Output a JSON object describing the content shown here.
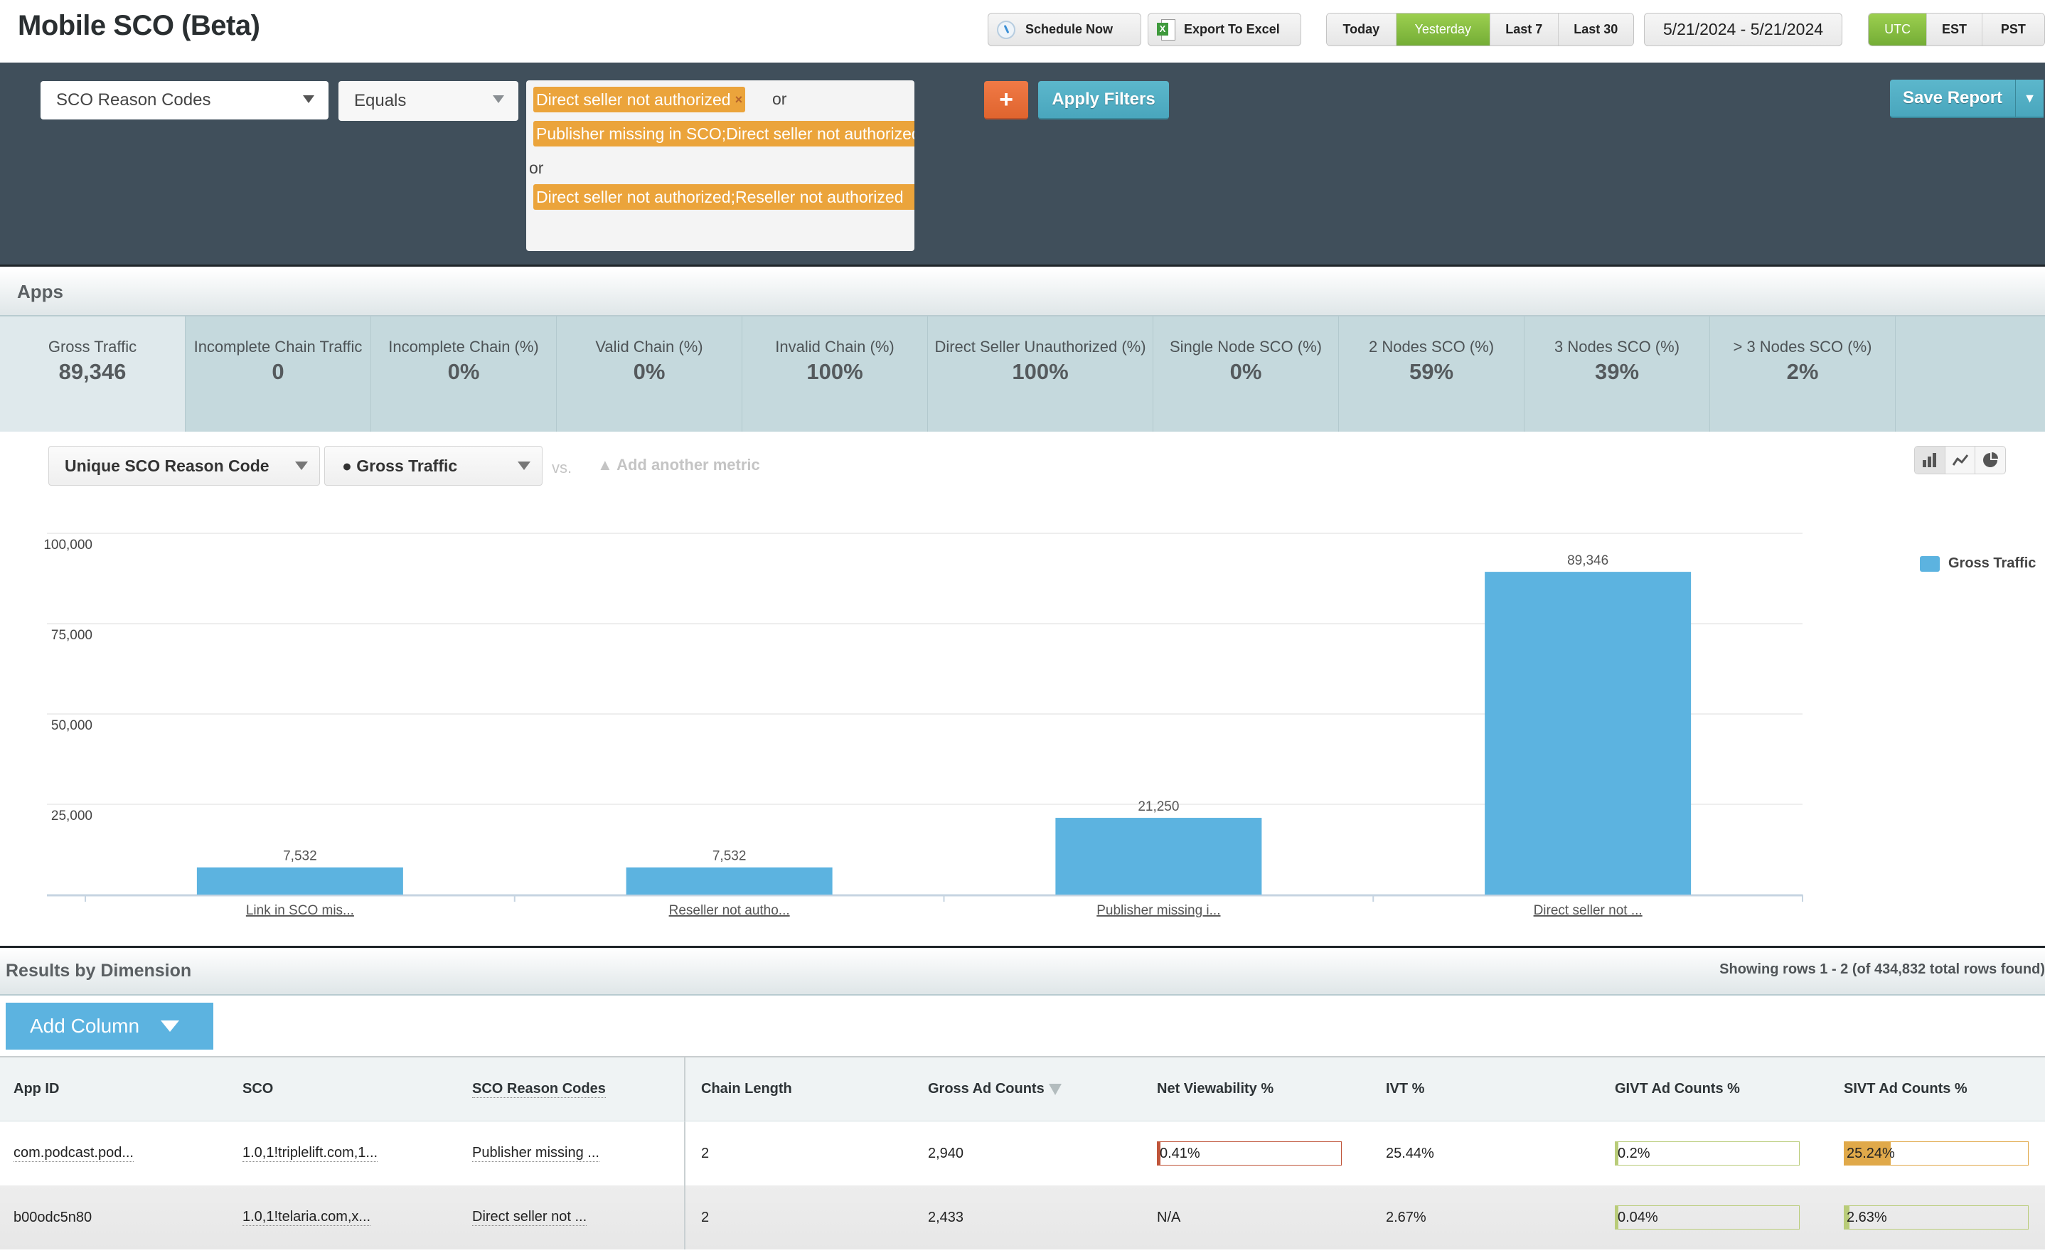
{
  "header": {
    "title": "Mobile SCO (Beta)",
    "schedule_label": "Schedule Now",
    "export_label": "Export To Excel",
    "date_presets": [
      {
        "label": "Today",
        "active": false
      },
      {
        "label": "Yesterday",
        "active": true
      },
      {
        "label": "Last 7",
        "active": false
      },
      {
        "label": "Last 30",
        "active": false
      }
    ],
    "date_range": "5/21/2024 - 5/21/2024",
    "timezones": [
      {
        "label": "UTC",
        "active": true
      },
      {
        "label": "EST",
        "active": false
      },
      {
        "label": "PST",
        "active": false
      }
    ]
  },
  "filters": {
    "dimension": "SCO Reason Codes",
    "operator": "Equals",
    "values": [
      "Direct seller not authorized",
      "Publisher missing in SCO;Direct seller not authorized",
      "Direct seller not authorized;Reseller not authorized"
    ],
    "or_label": "or",
    "remove_icon": "×",
    "add_label": "+",
    "apply_label": "Apply Filters",
    "save_label": "Save Report"
  },
  "apps": {
    "title": "Apps",
    "kpis": [
      {
        "label": "Gross Traffic",
        "value": "89,346"
      },
      {
        "label": "Incomplete Chain Traffic",
        "value": "0"
      },
      {
        "label": "Incomplete Chain (%)",
        "value": "0%"
      },
      {
        "label": "Valid Chain (%)",
        "value": "0%"
      },
      {
        "label": "Invalid Chain (%)",
        "value": "100%"
      },
      {
        "label": "Direct Seller Unauthorized (%)",
        "value": "100%"
      },
      {
        "label": "Single Node SCO (%)",
        "value": "0%"
      },
      {
        "label": "2 Nodes SCO (%)",
        "value": "59%"
      },
      {
        "label": "3 Nodes SCO (%)",
        "value": "39%"
      },
      {
        "label": "> 3 Nodes SCO (%)",
        "value": "2%"
      }
    ]
  },
  "chart_controls": {
    "dimension": "Unique SCO Reason Code",
    "metric": "● Gross Traffic",
    "vs_label": "vs.",
    "add_metric_label": "▲ Add another metric",
    "chart_types": [
      "bar-chart-icon",
      "line-chart-icon",
      "pie-chart-icon"
    ]
  },
  "chart_data": {
    "type": "bar",
    "title": "",
    "xlabel": "",
    "ylabel": "",
    "categories": [
      "Link in SCO mis...",
      "Reseller not autho...",
      "Publisher missing i...",
      "Direct seller not ..."
    ],
    "series": [
      {
        "name": "Gross Traffic",
        "color": "#5cb3e0",
        "values": [
          7532,
          7532,
          21250,
          89346
        ]
      }
    ],
    "data_labels": [
      "7,532",
      "7,532",
      "21,250",
      "89,346"
    ],
    "yticks": [
      25000,
      50000,
      75000,
      100000
    ],
    "ytick_labels": [
      "25,000",
      "50,000",
      "75,000",
      "100,000"
    ],
    "ylim": [
      0,
      100000
    ],
    "grid": true,
    "legend": "top-right"
  },
  "results": {
    "title": "Results by Dimension",
    "row_count": "Showing rows 1 - 2 (of 434,832 total rows found)",
    "add_column_label": "Add Column",
    "columns": [
      "App ID",
      "SCO",
      "SCO Reason Codes",
      "Chain Length",
      "Gross Ad Counts",
      "Net Viewability %",
      "IVT %",
      "GIVT Ad Counts %",
      "SIVT Ad Counts %"
    ],
    "sorted_column": "Gross Ad Counts",
    "rows": [
      {
        "app_id": "com.podcast.pod...",
        "sco": "1.0,1!triplelift.com,1...",
        "reason": "Publisher missing ...",
        "chain_length": "2",
        "gross_ad_counts": "2,940",
        "net_viewability": {
          "text": "0.41%",
          "pct": 0.41,
          "color": "#c0553a"
        },
        "ivt": "25.44%",
        "givt": {
          "text": "0.2%",
          "pct": 0.2,
          "color": "#b9cc79"
        },
        "sivt": {
          "text": "25.24%",
          "pct": 25.24,
          "color": "#e0a94a"
        }
      },
      {
        "app_id": "b00odc5n80",
        "sco": "1.0,1!telaria.com,x...",
        "reason": "Direct seller not ...",
        "chain_length": "2",
        "gross_ad_counts": "2,433",
        "net_viewability": {
          "text": "N/A",
          "pct": null,
          "color": null
        },
        "ivt": "2.67%",
        "givt": {
          "text": "0.04%",
          "pct": 0.04,
          "color": "#b9cc79"
        },
        "sivt": {
          "text": "2.63%",
          "pct": 2.63,
          "color": "#b9cc79"
        }
      }
    ]
  }
}
